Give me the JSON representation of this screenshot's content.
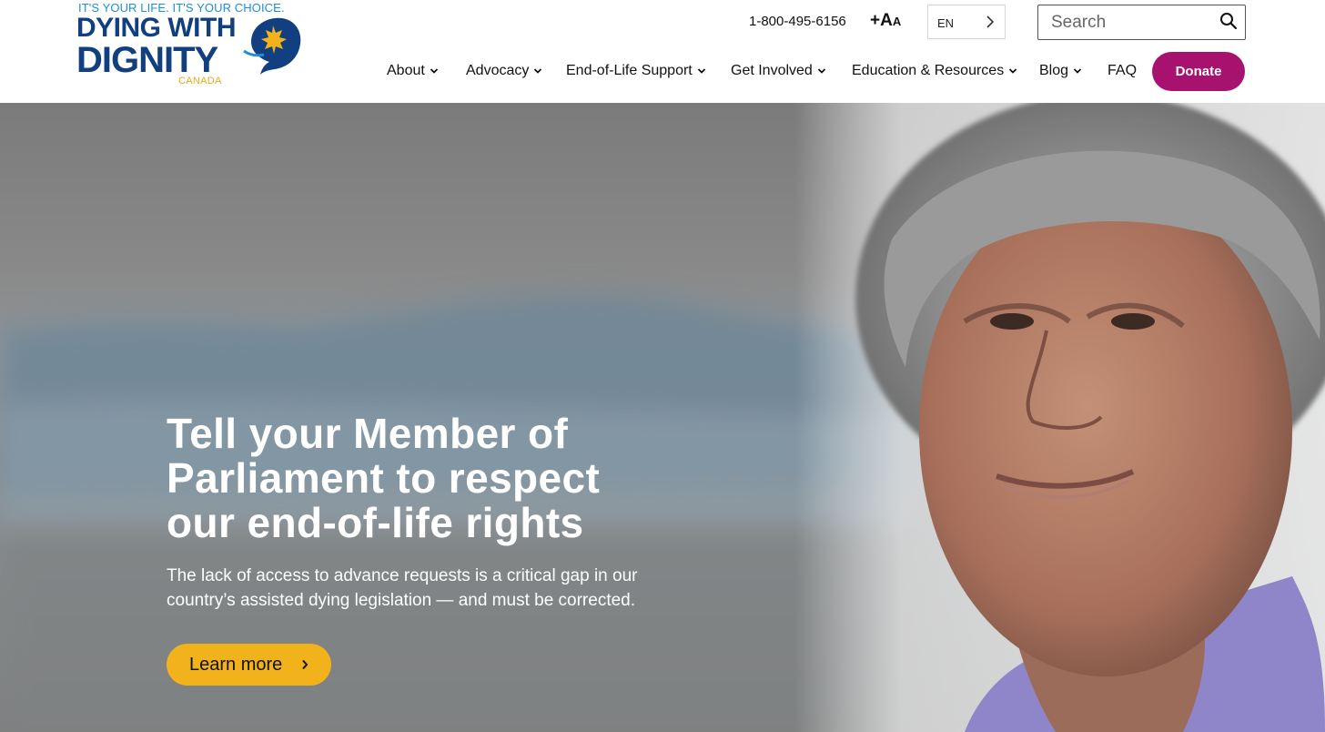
{
  "header": {
    "logo": {
      "tagline": "IT'S YOUR LIFE. IT'S YOUR CHOICE.",
      "line1": "DYING WITH",
      "line2": "DIGNITY",
      "country": "CANADA"
    },
    "phone": "1-800-495-6156",
    "text_size_label": "+A",
    "text_size_small": "A",
    "language": "EN",
    "search": {
      "placeholder": "Search"
    },
    "nav": [
      {
        "label": "About"
      },
      {
        "label": "Advocacy"
      },
      {
        "label": "End-of-Life Support"
      },
      {
        "label": "Get Involved"
      },
      {
        "label": "Education & Resources"
      },
      {
        "label": "Blog"
      },
      {
        "label": "FAQ"
      }
    ],
    "donate_label": "Donate"
  },
  "hero": {
    "headline": "Tell your Member of Parliament to respect our end-of-life rights",
    "subtext": "The lack of access to advance requests is a critical gap in our country’s assisted dying legislation — and must be corrected.",
    "cta_label": "Learn more"
  },
  "colors": {
    "brand_navy": "#123f80",
    "brand_blue": "#1f8fd0",
    "brand_gold": "#e7a91a",
    "donate_magenta": "#a6126e",
    "cta_yellow": "#f2b21b"
  },
  "icons": {
    "search": "search-icon",
    "language": "chevron-right-icon",
    "nav_caret": "chevron-down-icon",
    "cta_arrow": "chevron-right-icon"
  }
}
